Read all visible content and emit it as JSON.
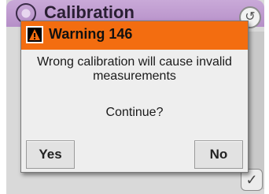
{
  "background_screen": {
    "title": "Calibration"
  },
  "dialog": {
    "title": "Warning 146",
    "message": "Wrong calibration will cause invalid measurements",
    "question": "Continue?",
    "yes_label": "Yes",
    "no_label": "No"
  },
  "colors": {
    "title_bar": "#f36d10",
    "dialog_bg": "#eeeeee",
    "header_purple": "#b68fc8"
  },
  "icons": {
    "warning": "warning-triangle-icon",
    "calibration": "calibration-icon",
    "back": "back-arrow-icon",
    "check": "check-icon"
  }
}
